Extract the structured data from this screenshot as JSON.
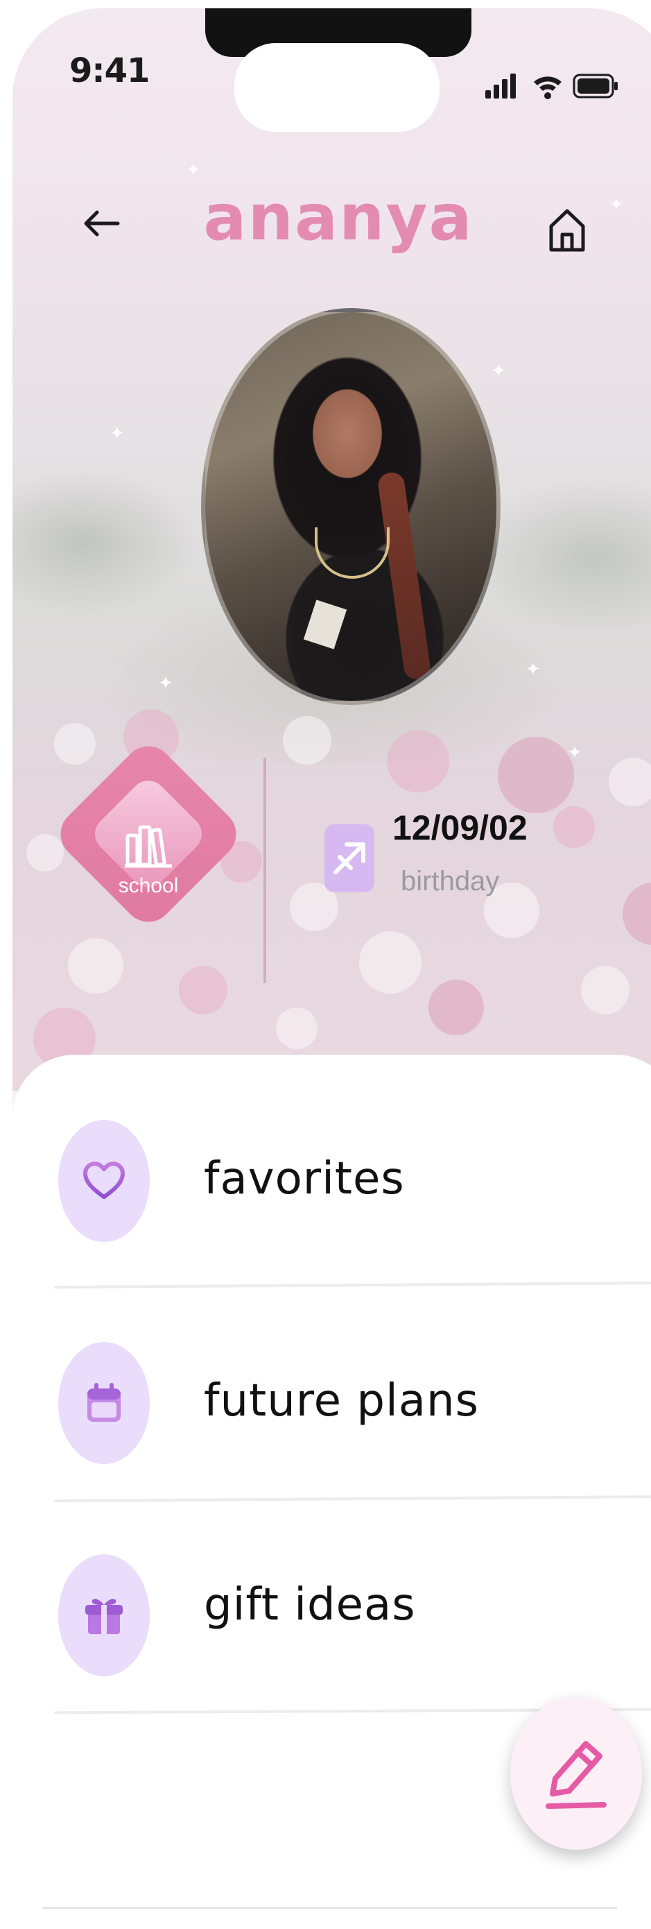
{
  "status_bar": {
    "time": "9:41"
  },
  "header": {
    "title": "ananya",
    "back_icon": "arrow-left-icon",
    "home_icon": "home-icon"
  },
  "profile": {
    "photo": "profile-photo",
    "category_badge": {
      "label": "school",
      "icon": "books-icon"
    },
    "birthday": {
      "date": "12/09/02",
      "label": "birthday",
      "zodiac_icon": "sagittarius-icon"
    }
  },
  "menu": {
    "items": [
      {
        "label": "favorites",
        "icon": "heart-icon"
      },
      {
        "label": "future plans",
        "icon": "calendar-icon"
      },
      {
        "label": "gift ideas",
        "icon": "gift-icon"
      }
    ]
  },
  "fab": {
    "icon": "pencil-icon"
  },
  "colors": {
    "title_pink": "#e38bb0",
    "badge_pink": "#e07a9f",
    "icon_circle_lavender": "#e9ddfb",
    "icon_purple": "#a565d8",
    "fab_pink": "#e65aa5"
  }
}
